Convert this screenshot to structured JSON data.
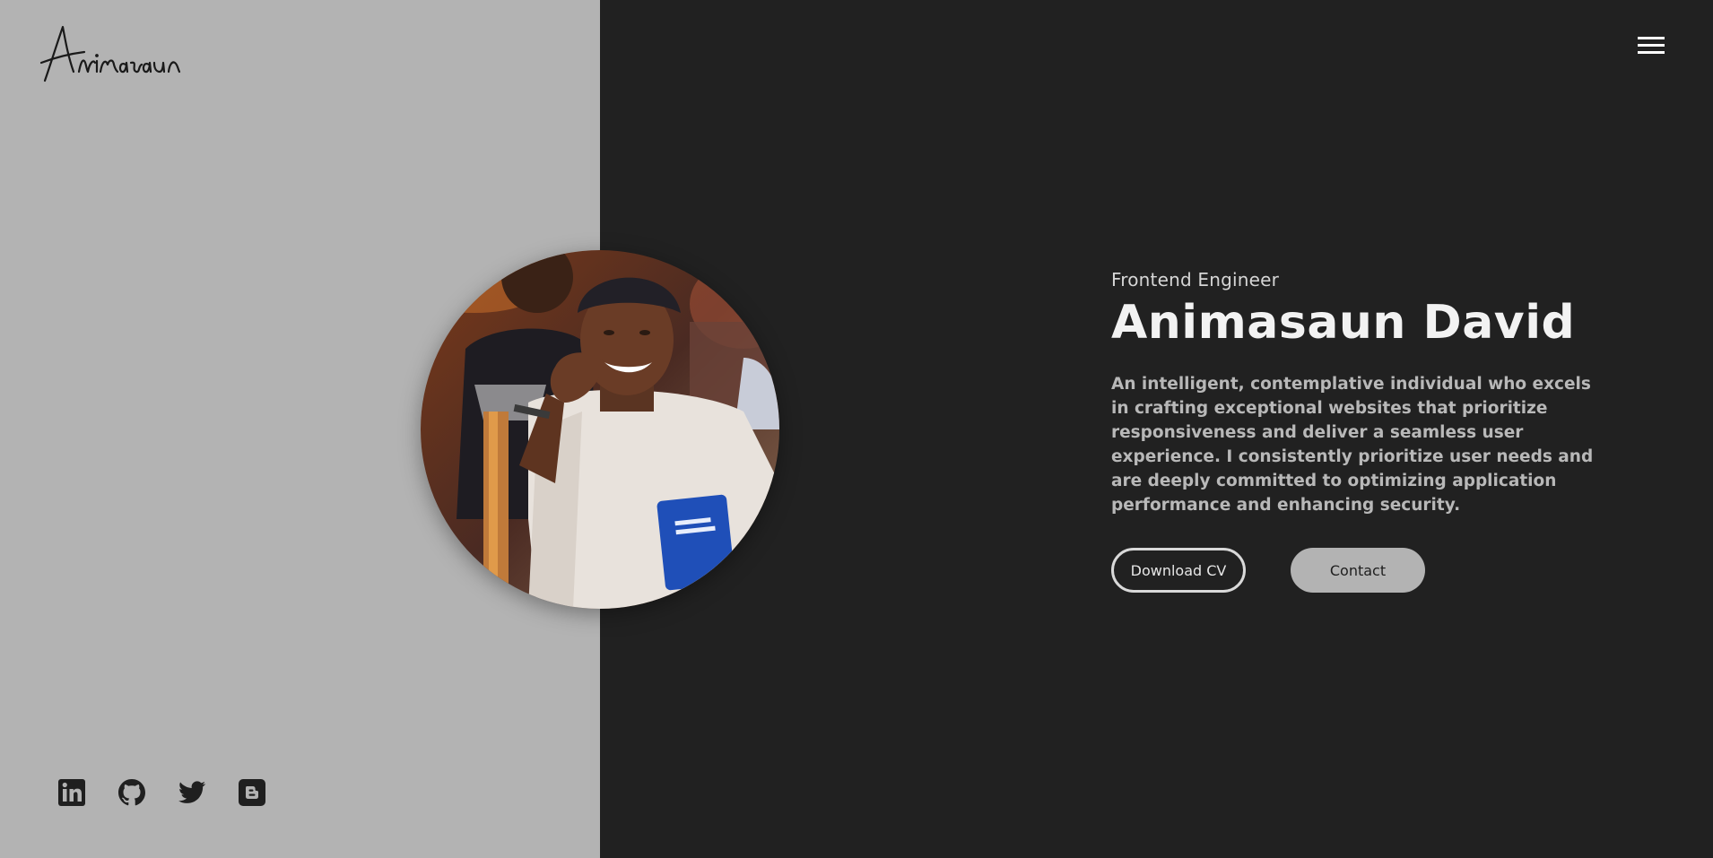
{
  "brand": {
    "logo_text": "Animasaun"
  },
  "nav": {
    "menu_icon": "hamburger-menu-icon"
  },
  "hero": {
    "role": "Frontend Engineer",
    "name": "Animasaun David",
    "bio": "An intelligent, contemplative individual who excels in crafting exceptional websites that prioritize responsiveness and deliver a seamless user experience. I consistently prioritize user needs and are deeply committed to optimizing application performance and enhancing security.",
    "download_cv_label": "Download CV",
    "contact_label": "Contact"
  },
  "social": {
    "icons": [
      "linkedin-icon",
      "github-icon",
      "twitter-icon",
      "blogger-icon"
    ]
  },
  "colors": {
    "left_panel": "#b3b3b3",
    "right_panel": "#212121",
    "heading": "#f2f2f2",
    "body_text": "#b8b8b8",
    "icon": "#1f1f1f"
  }
}
